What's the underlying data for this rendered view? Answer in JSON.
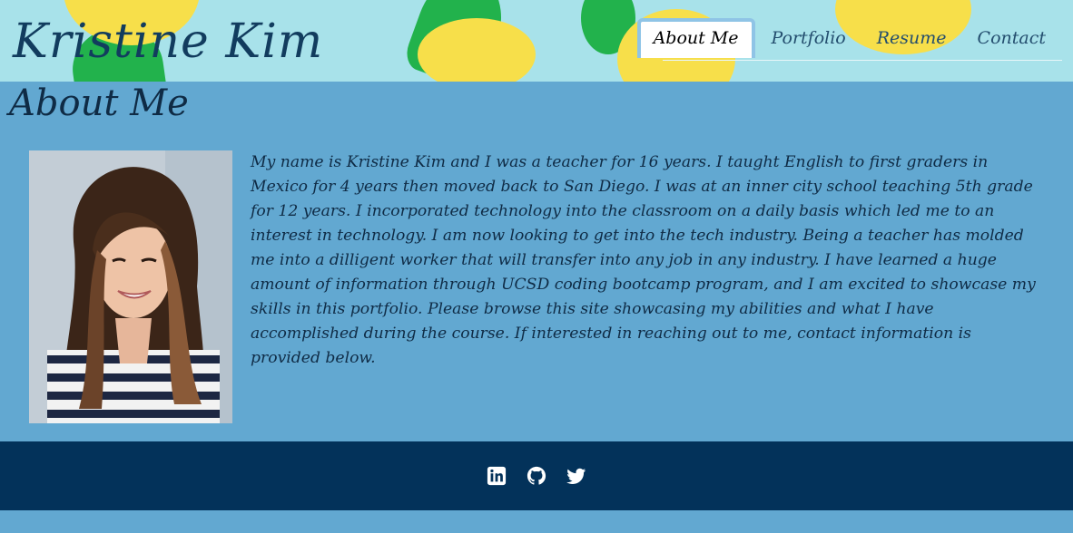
{
  "site": {
    "title": "Kristine Kim"
  },
  "nav": {
    "items": [
      {
        "label": "About Me",
        "active": true
      },
      {
        "label": "Portfolio",
        "active": false
      },
      {
        "label": "Resume",
        "active": false
      },
      {
        "label": "Contact",
        "active": false
      }
    ]
  },
  "main": {
    "heading": "About Me",
    "photo_alt": "photo of Kristine Kim",
    "bio": "My name is Kristine Kim and I was a teacher for 16 years. I taught English to first graders in Mexico for 4 years then moved back to San Diego. I was at an inner city school teaching 5th grade for 12 years. I incorporated technology into the classroom on a daily basis which led me to an interest in technology. I am now looking to get into the tech industry. Being a teacher has molded me into a dilligent worker that will transfer into any job in any industry. I have learned a huge amount of information through UCSD coding bootcamp program, and I am excited to showcase my skills in this portfolio. Please browse this site showcasing my abilities and what I have accomplished during the course. If interested in reaching out to me, contact information is provided below."
  },
  "footer": {
    "icons": [
      "linkedin-icon",
      "github-icon",
      "twitter-icon"
    ]
  },
  "colors": {
    "page_bg": "#62a8d1",
    "header_bg": "#a8e2ea",
    "footer_bg": "#03325a",
    "title_text": "#123c5e",
    "pineapple_fruit": "#f7df4a",
    "pineapple_leaf": "#22b24c"
  }
}
